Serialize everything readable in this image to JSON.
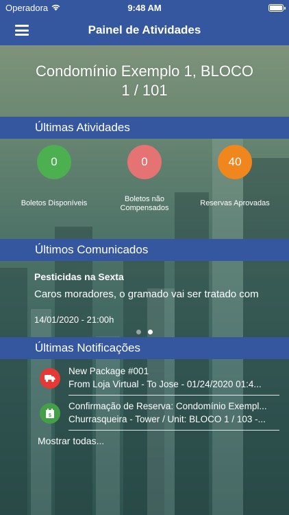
{
  "status_bar": {
    "carrier": "Operadora",
    "time": "9:48 AM"
  },
  "navbar": {
    "title": "Painel de Atividades"
  },
  "condo": {
    "name": "Condomínio Exemplo 1, BLOCO",
    "unit": "1 / 101"
  },
  "activities": {
    "title": "Últimas Atividades",
    "items": [
      {
        "value": "0",
        "label": "Boletos Disponíveis",
        "color": "#4caf50"
      },
      {
        "value": "0",
        "label": "Boletos não Compensados",
        "color": "#e57373"
      },
      {
        "value": "40",
        "label": "Reservas Aprovadas",
        "color": "#f0861e"
      }
    ]
  },
  "announcements": {
    "title": "Últimos Comunicados",
    "item": {
      "title": "Pesticidas na Sexta",
      "body": "Caros moradores, o gramado vai ser tratado com",
      "date": "14/01/2020 - 21:00h"
    },
    "page_count": 2,
    "active_page": 2
  },
  "notifications": {
    "title": "Últimas Notificações",
    "items": [
      {
        "icon": "truck-icon",
        "color": "#e53935",
        "line1": "New Package #001",
        "line2": "From Loja Virtual - To Jose - 01/24/2020 01:4..."
      },
      {
        "icon": "calendar-icon",
        "color": "#43a047",
        "line1": "Confirmação de Reserva: Condomínio Exempl...",
        "line2": "Churrasqueira - Tower / Unit: BLOCO 1 / 103 -..."
      }
    ],
    "show_all": "Mostrar todas..."
  }
}
